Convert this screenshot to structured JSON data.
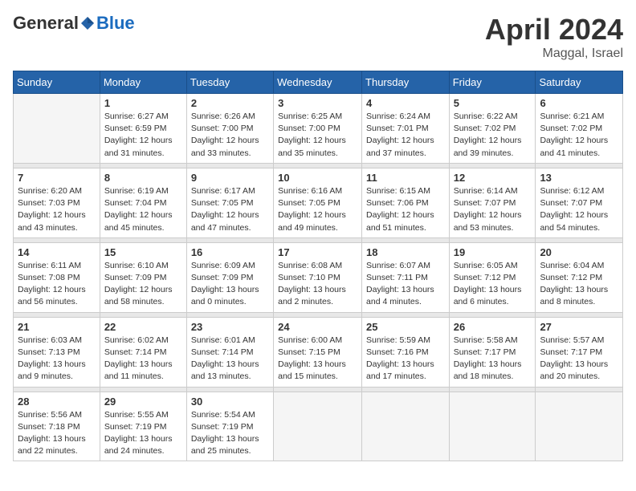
{
  "header": {
    "logo": {
      "general": "General",
      "blue": "Blue",
      "tagline": ""
    },
    "title": "April 2024",
    "location": "Maggal, Israel"
  },
  "columns": [
    "Sunday",
    "Monday",
    "Tuesday",
    "Wednesday",
    "Thursday",
    "Friday",
    "Saturday"
  ],
  "weeks": [
    {
      "days": [
        {
          "number": "",
          "info": ""
        },
        {
          "number": "1",
          "info": "Sunrise: 6:27 AM\nSunset: 6:59 PM\nDaylight: 12 hours\nand 31 minutes."
        },
        {
          "number": "2",
          "info": "Sunrise: 6:26 AM\nSunset: 7:00 PM\nDaylight: 12 hours\nand 33 minutes."
        },
        {
          "number": "3",
          "info": "Sunrise: 6:25 AM\nSunset: 7:00 PM\nDaylight: 12 hours\nand 35 minutes."
        },
        {
          "number": "4",
          "info": "Sunrise: 6:24 AM\nSunset: 7:01 PM\nDaylight: 12 hours\nand 37 minutes."
        },
        {
          "number": "5",
          "info": "Sunrise: 6:22 AM\nSunset: 7:02 PM\nDaylight: 12 hours\nand 39 minutes."
        },
        {
          "number": "6",
          "info": "Sunrise: 6:21 AM\nSunset: 7:02 PM\nDaylight: 12 hours\nand 41 minutes."
        }
      ]
    },
    {
      "days": [
        {
          "number": "7",
          "info": "Sunrise: 6:20 AM\nSunset: 7:03 PM\nDaylight: 12 hours\nand 43 minutes."
        },
        {
          "number": "8",
          "info": "Sunrise: 6:19 AM\nSunset: 7:04 PM\nDaylight: 12 hours\nand 45 minutes."
        },
        {
          "number": "9",
          "info": "Sunrise: 6:17 AM\nSunset: 7:05 PM\nDaylight: 12 hours\nand 47 minutes."
        },
        {
          "number": "10",
          "info": "Sunrise: 6:16 AM\nSunset: 7:05 PM\nDaylight: 12 hours\nand 49 minutes."
        },
        {
          "number": "11",
          "info": "Sunrise: 6:15 AM\nSunset: 7:06 PM\nDaylight: 12 hours\nand 51 minutes."
        },
        {
          "number": "12",
          "info": "Sunrise: 6:14 AM\nSunset: 7:07 PM\nDaylight: 12 hours\nand 53 minutes."
        },
        {
          "number": "13",
          "info": "Sunrise: 6:12 AM\nSunset: 7:07 PM\nDaylight: 12 hours\nand 54 minutes."
        }
      ]
    },
    {
      "days": [
        {
          "number": "14",
          "info": "Sunrise: 6:11 AM\nSunset: 7:08 PM\nDaylight: 12 hours\nand 56 minutes."
        },
        {
          "number": "15",
          "info": "Sunrise: 6:10 AM\nSunset: 7:09 PM\nDaylight: 12 hours\nand 58 minutes."
        },
        {
          "number": "16",
          "info": "Sunrise: 6:09 AM\nSunset: 7:09 PM\nDaylight: 13 hours\nand 0 minutes."
        },
        {
          "number": "17",
          "info": "Sunrise: 6:08 AM\nSunset: 7:10 PM\nDaylight: 13 hours\nand 2 minutes."
        },
        {
          "number": "18",
          "info": "Sunrise: 6:07 AM\nSunset: 7:11 PM\nDaylight: 13 hours\nand 4 minutes."
        },
        {
          "number": "19",
          "info": "Sunrise: 6:05 AM\nSunset: 7:12 PM\nDaylight: 13 hours\nand 6 minutes."
        },
        {
          "number": "20",
          "info": "Sunrise: 6:04 AM\nSunset: 7:12 PM\nDaylight: 13 hours\nand 8 minutes."
        }
      ]
    },
    {
      "days": [
        {
          "number": "21",
          "info": "Sunrise: 6:03 AM\nSunset: 7:13 PM\nDaylight: 13 hours\nand 9 minutes."
        },
        {
          "number": "22",
          "info": "Sunrise: 6:02 AM\nSunset: 7:14 PM\nDaylight: 13 hours\nand 11 minutes."
        },
        {
          "number": "23",
          "info": "Sunrise: 6:01 AM\nSunset: 7:14 PM\nDaylight: 13 hours\nand 13 minutes."
        },
        {
          "number": "24",
          "info": "Sunrise: 6:00 AM\nSunset: 7:15 PM\nDaylight: 13 hours\nand 15 minutes."
        },
        {
          "number": "25",
          "info": "Sunrise: 5:59 AM\nSunset: 7:16 PM\nDaylight: 13 hours\nand 17 minutes."
        },
        {
          "number": "26",
          "info": "Sunrise: 5:58 AM\nSunset: 7:17 PM\nDaylight: 13 hours\nand 18 minutes."
        },
        {
          "number": "27",
          "info": "Sunrise: 5:57 AM\nSunset: 7:17 PM\nDaylight: 13 hours\nand 20 minutes."
        }
      ]
    },
    {
      "days": [
        {
          "number": "28",
          "info": "Sunrise: 5:56 AM\nSunset: 7:18 PM\nDaylight: 13 hours\nand 22 minutes."
        },
        {
          "number": "29",
          "info": "Sunrise: 5:55 AM\nSunset: 7:19 PM\nDaylight: 13 hours\nand 24 minutes."
        },
        {
          "number": "30",
          "info": "Sunrise: 5:54 AM\nSunset: 7:19 PM\nDaylight: 13 hours\nand 25 minutes."
        },
        {
          "number": "",
          "info": ""
        },
        {
          "number": "",
          "info": ""
        },
        {
          "number": "",
          "info": ""
        },
        {
          "number": "",
          "info": ""
        }
      ]
    }
  ]
}
